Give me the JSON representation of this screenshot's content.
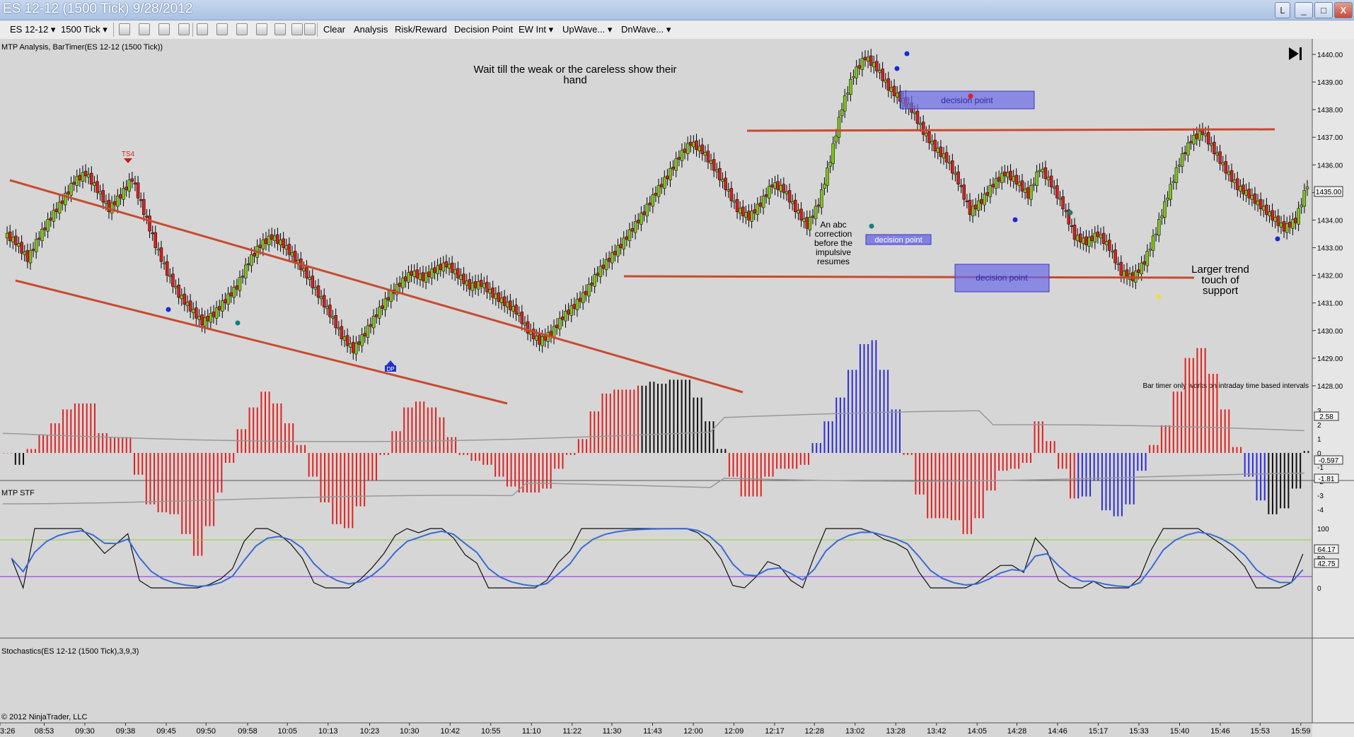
{
  "window": {
    "title": "ES 12-12 (1500 Tick)  9/28/2012",
    "buttons": {
      "link": "L",
      "minimize": "_",
      "maximize": "□",
      "close": "X"
    }
  },
  "toolbar": {
    "instrument": "ES 12-12",
    "interval": "1500 Tick",
    "clear": "Clear",
    "analysis": "Analysis",
    "risk_reward": "Risk/Reward",
    "decision_point": "Decision Point",
    "ew_int": "EW Int",
    "upwave": "UpWave...",
    "dnwave": "DnWave..."
  },
  "colors": {
    "up_bar": "#7ec31a",
    "down_bar": "#d42020",
    "trend_line": "#c84a30",
    "zone": "#6a6ae8"
  },
  "panels": {
    "price": {
      "label": "MTP Analysis, BarTimer(ES 12-12 (1500 Tick))",
      "annotation_main": [
        "Wait till the weak or the careless show their",
        "hand"
      ],
      "annotation_abc": [
        "An abc",
        "correction",
        "before the",
        "impulsive",
        "resumes"
      ],
      "annotation_support": [
        "Larger trend",
        "touch of",
        "support"
      ],
      "decision_zone_label": "decision point",
      "ts4_label": "TS4",
      "dp_label": "DP",
      "bar_timer_note": "Bar timer only works on intraday time based intervals",
      "last_price": "1435.00",
      "y_ticks": [
        "1440.00",
        "1439.00",
        "1438.00",
        "1437.00",
        "1436.00",
        "1435.00",
        "1434.00",
        "1433.00",
        "1432.00",
        "1431.00",
        "1430.00",
        "1429.00",
        "1428.00"
      ]
    },
    "stf": {
      "label": "MTP STF",
      "y_ticks": [
        "3",
        "2",
        "1",
        "0",
        "-1",
        "-2",
        "-3",
        "-4"
      ],
      "badges": [
        "2.58",
        "-0.597",
        "-1.81"
      ]
    },
    "stoch": {
      "label": "Stochastics(ES 12-12 (1500 Tick),3,9,3)",
      "y_ticks": [
        "100",
        "50",
        "0"
      ],
      "badges": [
        "64.17",
        "42.75"
      ],
      "copyright": "© 2012 NinjaTrader, LLC"
    }
  },
  "x_axis": {
    "labels": [
      "3:26",
      "08:53",
      "09:30",
      "09:38",
      "09:45",
      "09:50",
      "09:58",
      "10:05",
      "10:13",
      "10:23",
      "10:30",
      "10:42",
      "10:55",
      "11:10",
      "11:22",
      "11:30",
      "11:43",
      "12:00",
      "12:09",
      "12:17",
      "12:28",
      "13:02",
      "13:28",
      "13:42",
      "14:05",
      "14:28",
      "14:46",
      "15:17",
      "15:33",
      "15:40",
      "15:46",
      "15:53",
      "15:59"
    ]
  },
  "chart_data": {
    "type": "candlestick",
    "title": "ES 12-12 (1500 Tick)  9/28/2012",
    "ylim": [
      1428,
      1440.3
    ],
    "closes": [
      1433.2,
      1432.6,
      1433.4,
      1434.1,
      1434.7,
      1435.4,
      1435.7,
      1435.1,
      1434.4,
      1434.9,
      1435.5,
      1434.3,
      1433.1,
      1432.1,
      1431.3,
      1430.8,
      1430.3,
      1430.6,
      1431.1,
      1431.6,
      1432.5,
      1433.1,
      1433.4,
      1433.1,
      1432.6,
      1432.0,
      1431.3,
      1430.6,
      1429.8,
      1429.3,
      1429.9,
      1430.6,
      1431.2,
      1431.7,
      1432.1,
      1431.9,
      1432.2,
      1432.4,
      1432.0,
      1431.6,
      1431.7,
      1431.3,
      1431.0,
      1430.7,
      1430.0,
      1429.6,
      1429.9,
      1430.5,
      1430.9,
      1431.4,
      1432.1,
      1432.6,
      1433.1,
      1433.7,
      1434.3,
      1435.0,
      1435.6,
      1436.3,
      1436.8,
      1436.5,
      1435.9,
      1435.2,
      1434.4,
      1434.1,
      1434.6,
      1435.3,
      1435.1,
      1434.4,
      1433.8,
      1434.6,
      1436.2,
      1438.1,
      1439.3,
      1439.9,
      1439.5,
      1438.8,
      1438.4,
      1438.0,
      1437.2,
      1436.6,
      1436.2,
      1435.4,
      1434.3,
      1434.7,
      1435.3,
      1435.7,
      1435.4,
      1434.9,
      1435.9,
      1435.3,
      1434.5,
      1433.4,
      1433.2,
      1433.5,
      1433.0,
      1432.1,
      1431.9,
      1432.5,
      1433.6,
      1434.9,
      1436.1,
      1436.9,
      1437.2,
      1436.5,
      1435.8,
      1435.2,
      1434.9,
      1434.5,
      1434.1,
      1433.7,
      1434.0,
      1435.3
    ]
  }
}
